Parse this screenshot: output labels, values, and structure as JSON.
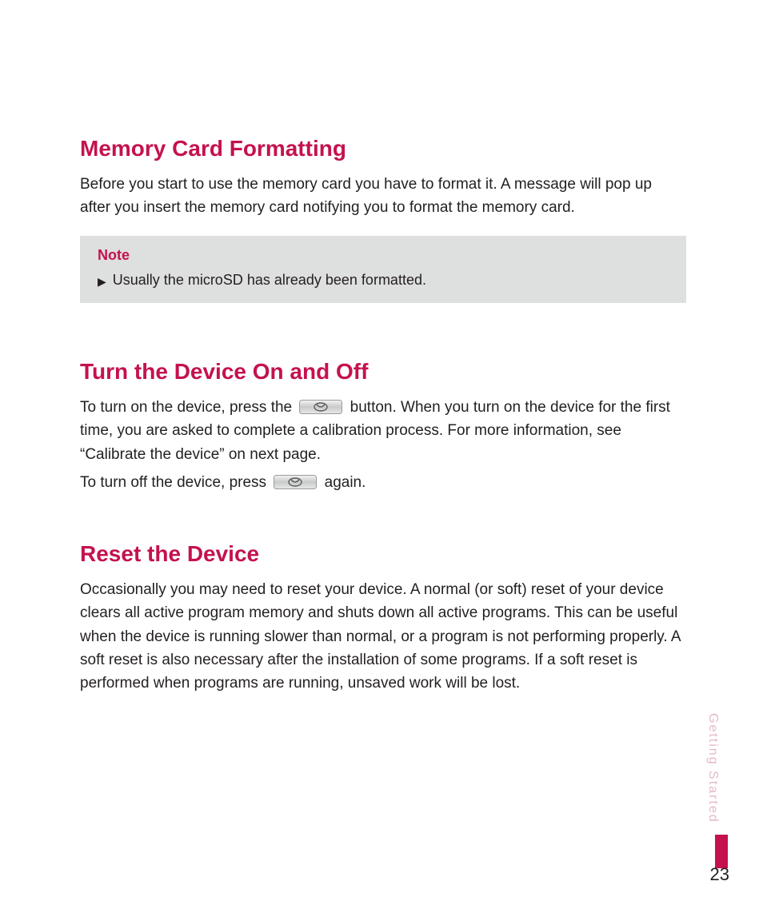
{
  "sections": {
    "memory": {
      "heading": "Memory Card Formatting",
      "body": "Before you start to use the memory card you have to format it. A message will pop up after you insert the memory card notifying you to format the memory card.",
      "note_title": "Note",
      "note_text": "Usually the microSD has already been formatted."
    },
    "power": {
      "heading": "Turn the Device On and Off",
      "body_a": "To turn on the device, press the ",
      "body_b": " button. When you turn on the device for the first time, you are asked to complete a calibration process. For more information, see “Calibrate the device” on next page.",
      "body2_a": "To turn off the device, press ",
      "body2_b": " again."
    },
    "reset": {
      "heading": "Reset the Device",
      "body": "Occasionally you may need to reset your device. A normal (or soft) reset of your device clears all active program memory and shuts down all active programs. This can be useful when the device is running slower than normal, or a program is not performing properly. A soft reset is also necessary after the installation of some programs. If a soft reset is performed when programs are running, unsaved work will be lost."
    }
  },
  "side_label": "Getting Started",
  "page_number": "23"
}
